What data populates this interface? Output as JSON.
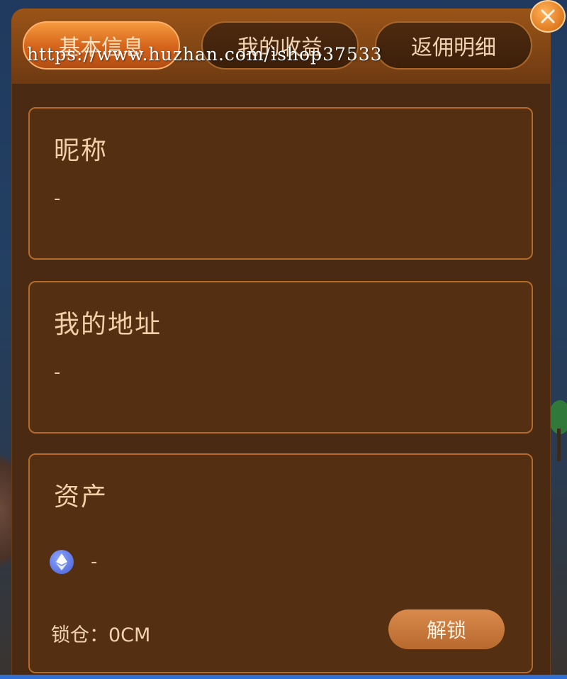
{
  "tabs": [
    {
      "label": "基本信息",
      "active": true
    },
    {
      "label": "我的收益",
      "active": false
    },
    {
      "label": "返佣明细",
      "active": false
    }
  ],
  "close_icon": "close-x-icon",
  "nickname": {
    "title": "昵称",
    "value": "-"
  },
  "address": {
    "title": "我的地址",
    "value": "-"
  },
  "assets": {
    "title": "资产",
    "token_icon": "ethereum-icon",
    "token_value": "-",
    "locked_text": "锁仓：0CM",
    "unlock_label": "解锁"
  },
  "watermark": "https://www.huzhan.com/ishop37533",
  "colors": {
    "panel": "#4a2a12",
    "card": "#542f12",
    "card_border": "#b36a2a",
    "accent": "#e07a1f",
    "text": "#f2cfa8"
  }
}
